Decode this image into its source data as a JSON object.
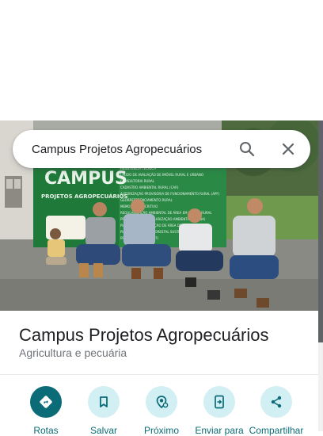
{
  "search": {
    "query": "Campus Projetos Agropecuários"
  },
  "sign": {
    "brand": "CAMPUS",
    "subtitle": "PROJETOS AGROPECUÁRIOS",
    "services": [
      "ASSISTÊNCIA TÉCNICA",
      "LAUDO DE AVALIAÇÃO DE IMÓVEL RURAL E URBANO",
      "CONSULTORIA RURAL",
      "CADASTRO AMBIENTAL RURAL (CAR)",
      "AUTORIZAÇÃO PROVISÓRIA DE FUNCIONAMENTO RURAL (APF)",
      "GEORREFERENCIAMENTO RURAL",
      "MEMORIAL DESCRITIVO",
      "REGULARIZAÇÃO AMBIENTAL DE ÁREA EM IMÓVEL RURAL",
      "PROGRAMA DE REGULARIZAÇÃO AMBIENTAL (PRADA)",
      "PLANO DE RECUPERAÇÃO DE ÁREA DEGRADADA",
      "PLANO DE MANEJO FLORESTAL SUSTENTÁVEL",
      "PROJETO TÉCNICO (PTF)"
    ]
  },
  "place": {
    "name": "Campus Projetos Agropecuários",
    "category": "Agricultura e pecuária"
  },
  "actions": [
    {
      "label": "Rotas",
      "icon": "directions-icon"
    },
    {
      "label": "Salvar",
      "icon": "bookmark-icon"
    },
    {
      "label": "Próximo",
      "icon": "nearby-icon"
    },
    {
      "label": "Enviar para",
      "icon": "send-to-phone-icon"
    },
    {
      "label": "Compartilhar",
      "icon": "share-icon"
    }
  ],
  "colors": {
    "accent": "#0b6b76",
    "accent_light": "#d2eff4",
    "sign_green": "#1f7a3a"
  }
}
